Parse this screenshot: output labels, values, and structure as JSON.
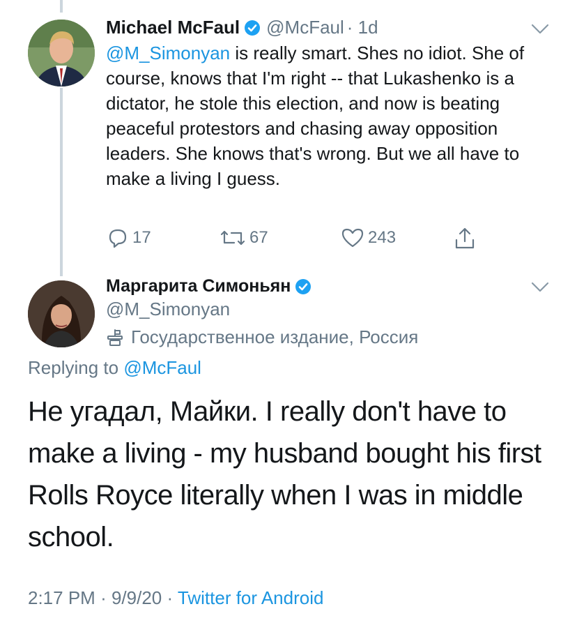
{
  "tweet1": {
    "name": "Michael McFaul",
    "handle": "@McFaul",
    "time": "· 1d",
    "mention": "@M_Simonyan",
    "text": " is really smart. Shes no idiot. She of course, knows that I'm right -- that Lukashenko is a dictator, he stole this election, and now is beating peaceful protestors and chasing away opposition leaders. She knows that's wrong.  But we all have to make a living I guess.",
    "replies": "17",
    "retweets": "67",
    "likes": "243"
  },
  "tweet2": {
    "name": "Маргарита Симоньян",
    "handle": "@M_Simonyan",
    "label": "Государственное издание, Россия",
    "replying_prefix": "Replying to ",
    "replying_to": "@McFaul",
    "text": "Не угадал, Майки. I really don't have to make a living - my husband bought his first Rolls Royce literally when I was in middle school.",
    "time": "2:17 PM",
    "date": "9/9/20",
    "source": "Twitter for Android"
  },
  "colors": {
    "accent": "#1b95e0",
    "muted": "#657786",
    "verified": "#1da1f2"
  },
  "icons": [
    "verified-badge-icon",
    "chevron-down-icon",
    "reply-icon",
    "retweet-icon",
    "like-icon",
    "share-icon",
    "state-media-icon"
  ]
}
